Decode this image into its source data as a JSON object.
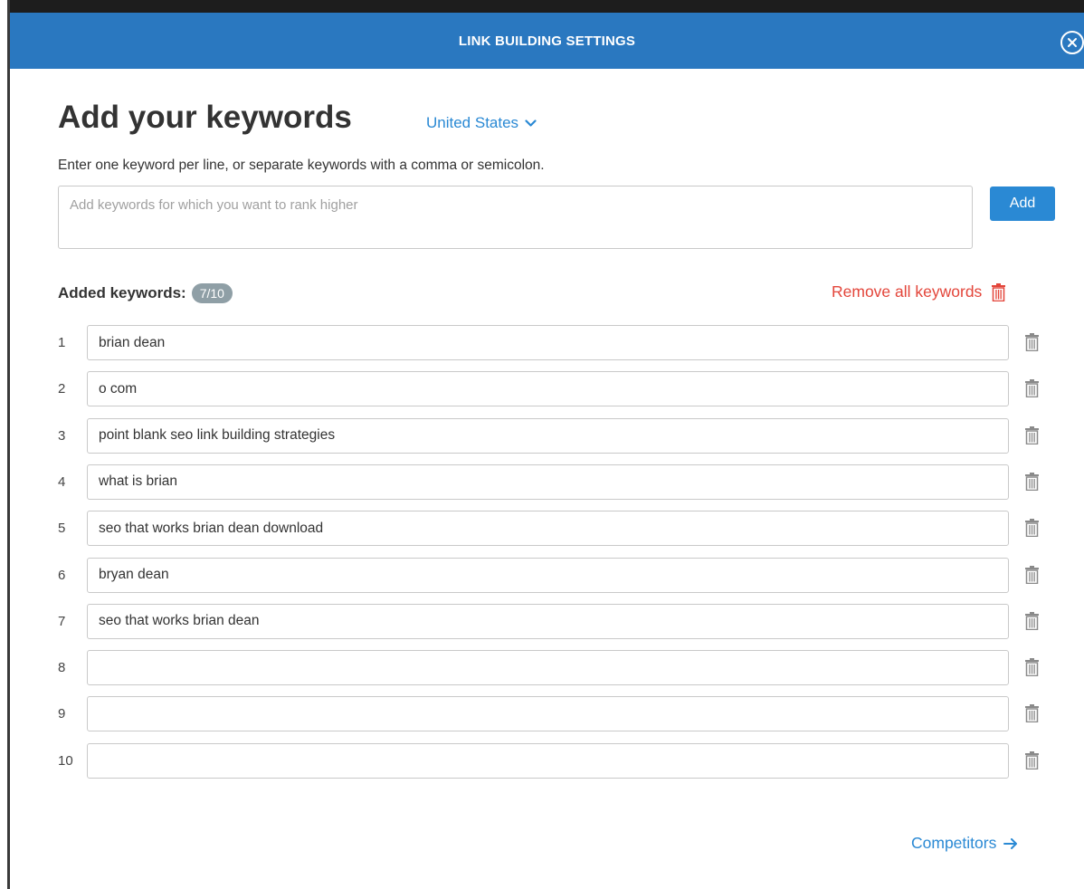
{
  "header": {
    "title": "LINK BUILDING SETTINGS",
    "close_icon": "close-circle-icon"
  },
  "main": {
    "title": "Add your keywords",
    "country": {
      "label": "United States",
      "icon": "chevron-down-icon"
    },
    "hint": "Enter one keyword per line, or separate keywords with a comma or semicolon.",
    "textarea": {
      "placeholder": "Add keywords for which you want to rank higher",
      "value": ""
    },
    "add_label": "Add"
  },
  "added": {
    "label": "Added keywords:",
    "count": "7/10",
    "remove_all_label": "Remove all keywords",
    "colors": {
      "remove": "#e3453a",
      "badge": "#8f9fa6"
    }
  },
  "keywords": [
    {
      "num": "1",
      "value": "brian dean"
    },
    {
      "num": "2",
      "value": "o com"
    },
    {
      "num": "3",
      "value": "point blank seo link building strategies"
    },
    {
      "num": "4",
      "value": "what is brian"
    },
    {
      "num": "5",
      "value": "seo that works brian dean download"
    },
    {
      "num": "6",
      "value": "bryan dean"
    },
    {
      "num": "7",
      "value": "seo that works brian dean"
    },
    {
      "num": "8",
      "value": ""
    },
    {
      "num": "9",
      "value": ""
    },
    {
      "num": "10",
      "value": ""
    }
  ],
  "footer": {
    "competitors_label": "Competitors",
    "icon": "arrow-right-icon"
  },
  "colors": {
    "header": "#2a78c0",
    "accent": "#2a89d4"
  }
}
